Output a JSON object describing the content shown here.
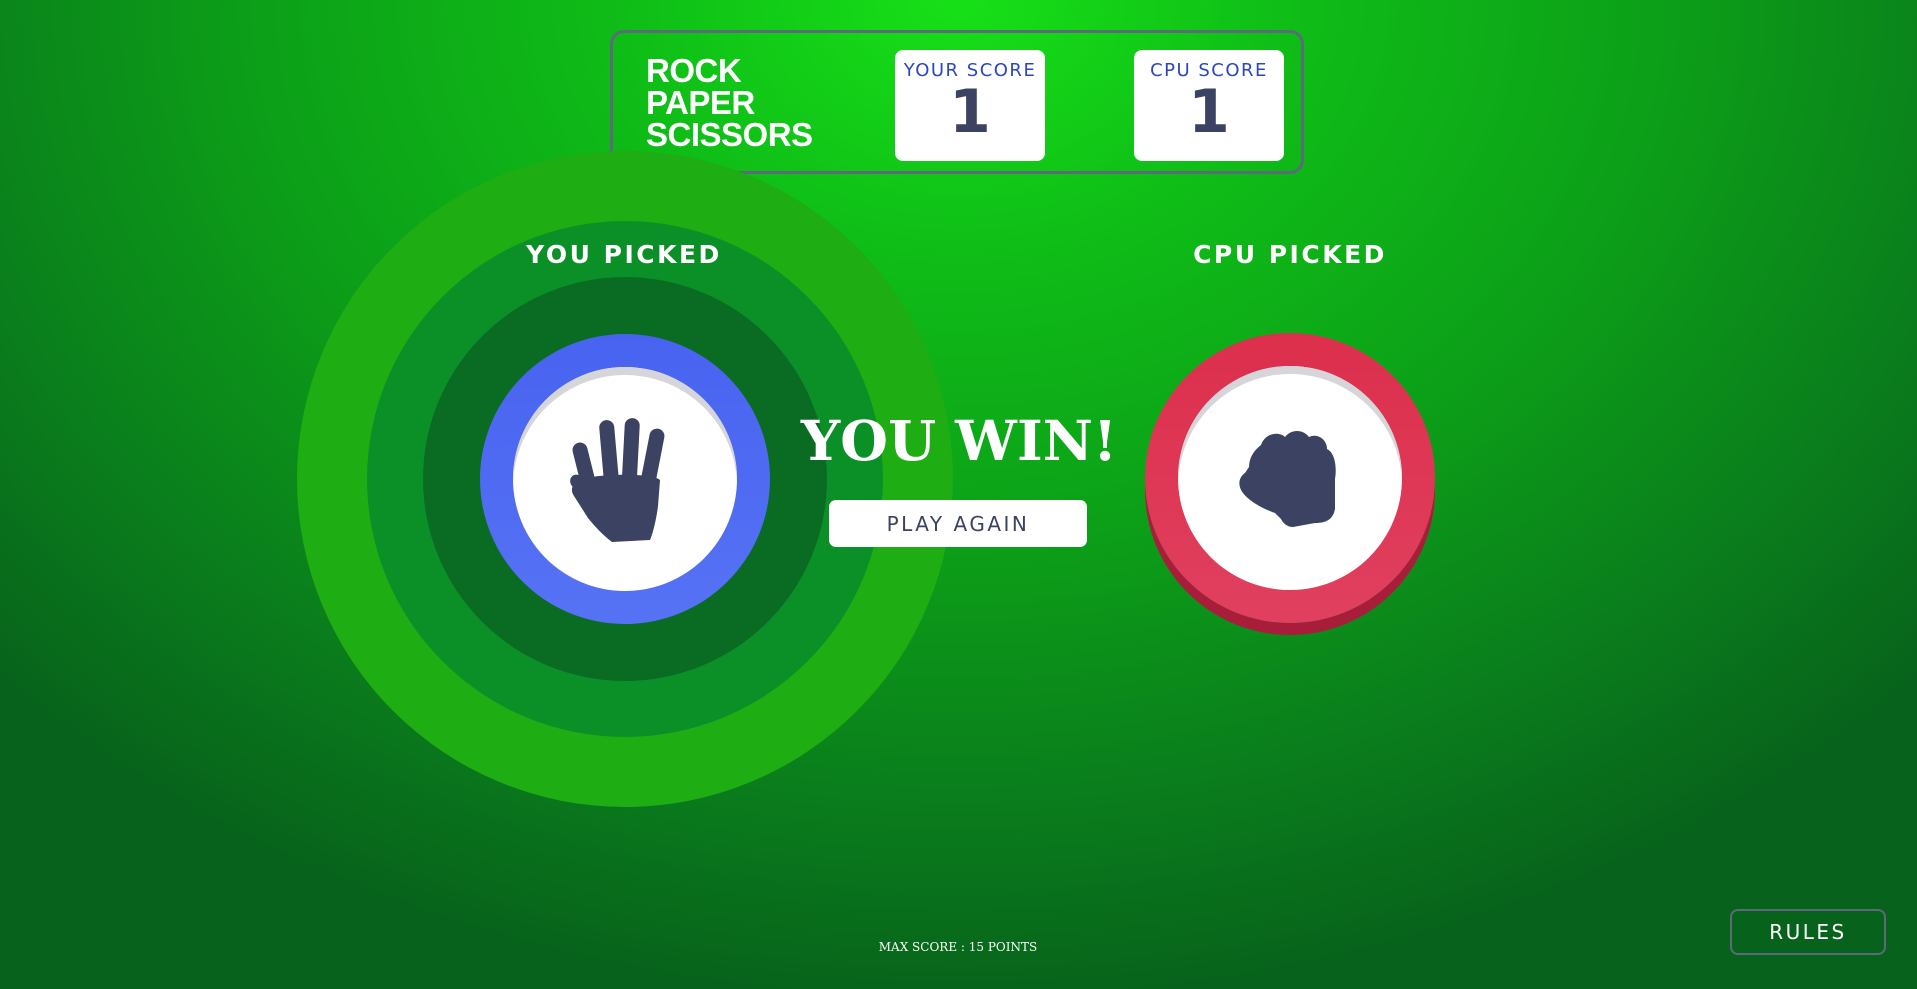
{
  "header": {
    "title_lines": [
      "ROCK",
      "PAPER",
      "SCISSORS"
    ],
    "your_score_label": "YOUR SCORE",
    "your_score_value": "1",
    "cpu_score_label": "CPU SCORE",
    "cpu_score_value": "1"
  },
  "game": {
    "you_picked_label": "YOU PICKED",
    "cpu_picked_label": "CPU PICKED",
    "you_choice_icon": "paper-hand-icon",
    "cpu_choice_icon": "rock-fist-icon",
    "result_text": "YOU WIN!",
    "play_again_label": "PLAY AGAIN"
  },
  "footer": {
    "max_score_text": "MAX SCORE : 15 POINTS",
    "rules_label": "RULES"
  },
  "colors": {
    "paper_token": "#4863f0",
    "rock_token": "#dc2f4c",
    "icon_color": "#3b4262",
    "score_label_color": "#2a46c0",
    "background_green": "#0c9e18"
  }
}
